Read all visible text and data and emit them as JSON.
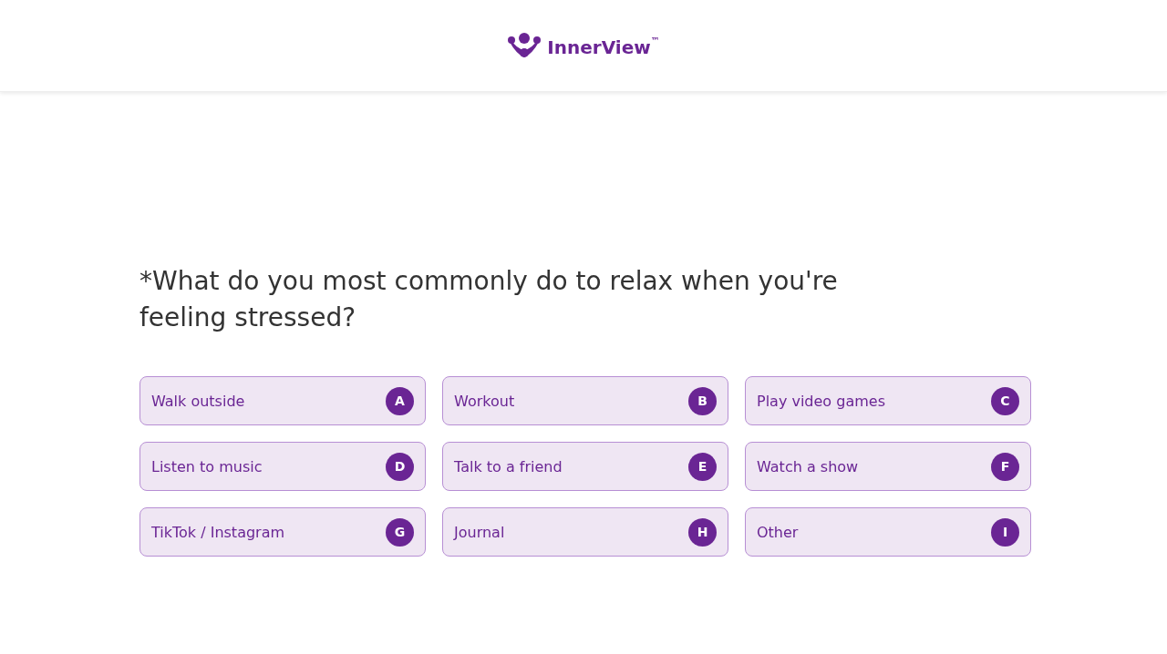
{
  "header": {
    "logo_text": "InnerView",
    "trademark": "™"
  },
  "question": {
    "text": "*What do you most commonly do to relax when you're feeling stressed?"
  },
  "options": [
    {
      "label": "Walk outside",
      "key": "A",
      "selected": false
    },
    {
      "label": "Workout",
      "key": "B",
      "selected": false
    },
    {
      "label": "Play video games",
      "key": "C",
      "selected": false
    },
    {
      "label": "Listen to music",
      "key": "D",
      "selected": false
    },
    {
      "label": "Talk to a friend",
      "key": "E",
      "selected": false
    },
    {
      "label": "Watch a show",
      "key": "F",
      "selected": false
    },
    {
      "label": "TikTok / Instagram",
      "key": "G",
      "selected": false
    },
    {
      "label": "Journal",
      "key": "H",
      "selected": false
    },
    {
      "label": "Other",
      "key": "I",
      "selected": false
    }
  ]
}
